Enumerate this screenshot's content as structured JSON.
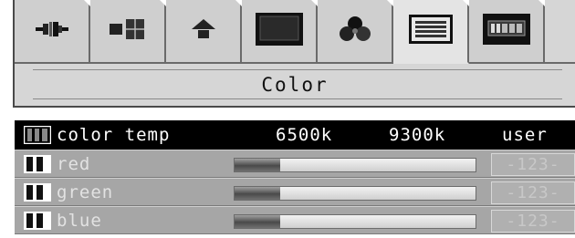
{
  "menu": {
    "tabs": [
      {
        "icon": "cable-icon",
        "active": false
      },
      {
        "icon": "window-position-icon",
        "active": false
      },
      {
        "icon": "arrow-up-icon",
        "active": false
      },
      {
        "icon": "monitor-icon",
        "active": false
      },
      {
        "icon": "color-circles-icon",
        "active": false
      },
      {
        "icon": "text-lines-icon",
        "active": true
      },
      {
        "icon": "abcd-language-icon",
        "active": false
      }
    ],
    "title": "Color"
  },
  "settings": {
    "color_temp": {
      "label": "color temp",
      "options": [
        "6500k",
        "9300k",
        "user"
      ]
    },
    "channels": [
      {
        "label": "red",
        "level": 0.19,
        "value": "-123-"
      },
      {
        "label": "green",
        "level": 0.19,
        "value": "-123-"
      },
      {
        "label": "blue",
        "level": 0.19,
        "value": "-123-"
      }
    ]
  },
  "colors": {
    "panel": "#d6d6d6",
    "selected_row": "#000000",
    "row": "#a6a6a6"
  }
}
